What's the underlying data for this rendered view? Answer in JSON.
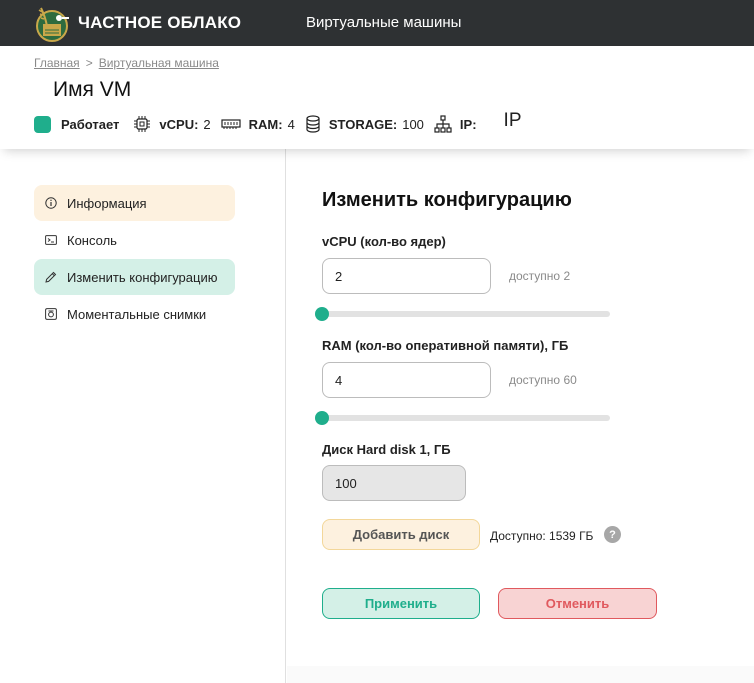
{
  "topbar": {
    "brand": "ЧАСТНОЕ ОБЛАКО",
    "nav_link": "Виртуальные машины",
    "logo_icon": "wheat-logo-icon"
  },
  "breadcrumb": {
    "home": "Главная",
    "separator": ">",
    "current": "Виртуальная машина"
  },
  "vm": {
    "title": "Имя VM",
    "status": "Работает",
    "status_color": "#1fae8c",
    "vcpu_label": "vCPU:",
    "vcpu_value": "2",
    "ram_label": "RAM:",
    "ram_value": "4",
    "storage_label": "STORAGE:",
    "storage_value": "100",
    "ip_label": "IP:",
    "ip_value": "IP"
  },
  "sidebar": {
    "items": [
      {
        "label": "Информация",
        "icon": "info-icon"
      },
      {
        "label": "Консоль",
        "icon": "console-icon"
      },
      {
        "label": "Изменить конфигурацию",
        "icon": "edit-icon"
      },
      {
        "label": "Моментальные снимки",
        "icon": "snapshot-icon"
      }
    ]
  },
  "form": {
    "title": "Изменить конфигурацию",
    "vcpu": {
      "label": "vCPU (кол-во ядер)",
      "value": "2",
      "available": "доступно 2",
      "slider_fraction": 0
    },
    "ram": {
      "label": "RAM (кол-во оперативной памяти), ГБ",
      "value": "4",
      "available": "доступно 60",
      "slider_fraction": 0
    },
    "disk": {
      "label": "Диск Hard disk 1, ГБ",
      "value": "100"
    },
    "add_disk": "Добавить диск",
    "free_space": "Доступно: 1539 ГБ",
    "help": "?",
    "apply": "Применить",
    "cancel": "Отменить"
  },
  "colors": {
    "accent": "#1fae8c",
    "topbar": "#2e3133",
    "danger": "#e0595e",
    "warning_bg": "#fdf1df"
  }
}
